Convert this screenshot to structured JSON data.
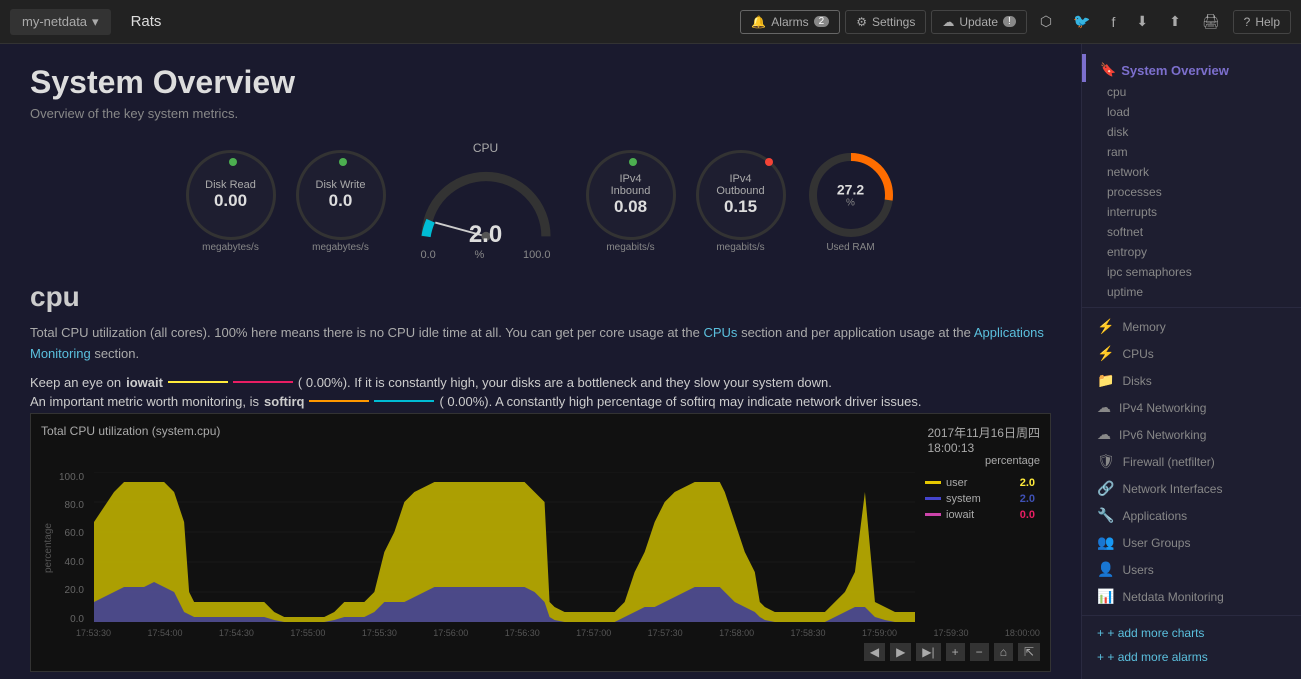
{
  "topnav": {
    "brand": "my-netdata",
    "title": "Rats",
    "alarms_label": "Alarms",
    "alarms_count": "2",
    "settings_label": "Settings",
    "update_label": "Update",
    "update_badge": "!",
    "help_label": "Help"
  },
  "page": {
    "title": "System Overview",
    "subtitle": "Overview of the key system metrics."
  },
  "gauges": {
    "disk_read": {
      "label": "Disk Read",
      "value": "0.00",
      "unit": "megabytes/s",
      "dot": "green"
    },
    "disk_write": {
      "label": "Disk Write",
      "value": "0.0",
      "unit": "megabytes/s",
      "dot": "green"
    },
    "cpu": {
      "label": "CPU",
      "value": "2.0",
      "range_min": "0.0",
      "range_max": "100.0",
      "unit": "%"
    },
    "ipv4_inbound": {
      "label": "IPv4\nInbound",
      "value": "0.08",
      "unit": "megabits/s",
      "dot": "green"
    },
    "ipv4_outbound": {
      "label": "IPv4\nOutbound",
      "value": "0.15",
      "unit": "megabits/s",
      "dot": "red"
    },
    "used_ram": {
      "label": "Used RAM",
      "value": "27.2",
      "unit": "%",
      "color": "#ff6d00"
    }
  },
  "cpu_section": {
    "title": "cpu",
    "desc1": "Total CPU utilization (all cores). 100% here means there is no CPU idle time at all. You can get per core usage at the",
    "cpus_link": "CPUs",
    "desc2": "section and per application usage at the",
    "apps_link": "Applications Monitoring",
    "desc3": "section.",
    "iowait_desc": "Keep an eye on",
    "iowait_word": "iowait",
    "iowait_end": "(     0.00%). If it is constantly high, your disks are a bottleneck and they slow your system down.",
    "softirq_desc": "An important metric worth monitoring, is",
    "softirq_word": "softirq",
    "softirq_end": "(     0.00%). A constantly high percentage of softirq may indicate network driver issues."
  },
  "chart": {
    "title": "Total CPU utilization (system.cpu)",
    "timestamp_line1": "2017年11月16日周四",
    "timestamp_line2": "18:00:13",
    "percentage_label": "percentage",
    "y_labels": [
      "100.0",
      "80.0",
      "60.0",
      "40.0",
      "20.0",
      "0.0"
    ],
    "x_labels": [
      "17:53:30",
      "17:54:00",
      "17:54:30",
      "17:55:00",
      "17:55:30",
      "17:56:00",
      "17:56:30",
      "17:57:00",
      "17:57:30",
      "17:58:00",
      "17:58:30",
      "17:59:00",
      "17:59:30",
      "18:00:00"
    ],
    "legend": [
      {
        "name": "user",
        "color": "#e5c700",
        "value": "2.0"
      },
      {
        "name": "system",
        "color": "#4444cc",
        "value": "2.0"
      },
      {
        "name": "iowait",
        "color": "#cc44aa",
        "value": "0.0"
      }
    ],
    "y_axis_label": "percentage"
  },
  "sidebar": {
    "system_overview": "System Overview",
    "items_plain": [
      "cpu",
      "load",
      "disk",
      "ram",
      "network",
      "processes",
      "interrupts",
      "softnet",
      "entropy",
      "ipc semaphores",
      "uptime"
    ],
    "groups": [
      {
        "icon": "⚡",
        "label": "Memory"
      },
      {
        "icon": "⚡",
        "label": "CPUs"
      },
      {
        "icon": "📁",
        "label": "Disks"
      },
      {
        "icon": "☁",
        "label": "IPv4 Networking"
      },
      {
        "icon": "☁",
        "label": "IPv6 Networking"
      },
      {
        "icon": "🛡",
        "label": "Firewall (netfilter)"
      },
      {
        "icon": "🔗",
        "label": "Network Interfaces"
      },
      {
        "icon": "🔧",
        "label": "Applications"
      },
      {
        "icon": "👥",
        "label": "User Groups"
      },
      {
        "icon": "👤",
        "label": "Users"
      },
      {
        "icon": "📊",
        "label": "Netdata Monitoring"
      }
    ],
    "add_charts": "+ add more charts",
    "add_alarms": "+ add more alarms"
  }
}
